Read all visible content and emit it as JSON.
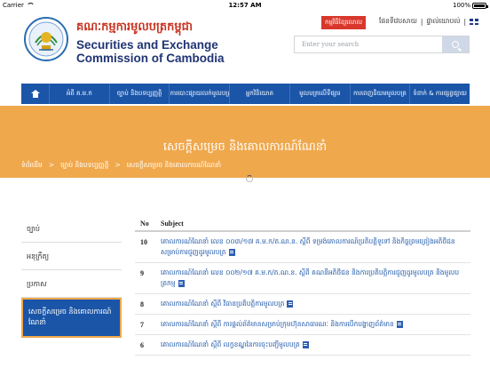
{
  "status_bar": {
    "carrier": "Carrier",
    "time": "12:57 AM",
    "battery": "100%",
    "battery_level": 1.0
  },
  "header": {
    "org_name_kh": "គណៈកម្មការមូលបត្រកម្ពុជា",
    "org_name_en_line1": "Securities and Exchange",
    "org_name_en_line2": "Commission of Cambodia",
    "complaint_button": "កម្មវិធីខ្សែលោល",
    "link_map": "ផែនទីវេបសាយ",
    "link_contact": "ផ្ទាល់យោបល់",
    "search_placeholder": "Enter your search"
  },
  "nav": {
    "items": [
      "អំពី គ.ម.ក",
      "ច្បាប់ និងបទប្បញ្ញត្តិ",
      "ការបោះផ្សាយលក់មូលបត្រ",
      "អ្នកវិនិយោគ",
      "មូលបត្រលើទីផ្សារ",
      "ការពេញនិយមមូលបត្រ",
      "ទំនាក់ & ការផ្សព្វផ្សាយ"
    ]
  },
  "banner": {
    "title": "សេចក្តីសម្រេច និងគោលការណ៍ណែនាំ",
    "breadcrumb": [
      "ទំព័រដើម",
      ">",
      "ច្បាប់ និងបទប្បញ្ញត្តិ",
      ">",
      "សេចក្តីសម្រេច និងគោលការណ៍ណែនាំ"
    ]
  },
  "sidebar": {
    "items": [
      {
        "label": "ច្បាប់",
        "active": false
      },
      {
        "label": "អនុក្រឹត្យ",
        "active": false
      },
      {
        "label": "ប្រកាស",
        "active": false
      },
      {
        "label": "សេចក្តីសម្រេច និងគោលការណ៍ណែនាំ",
        "active": true
      }
    ]
  },
  "table": {
    "headers": {
      "no": "No",
      "subject": "Subject"
    },
    "rows": [
      {
        "no": "10",
        "subject": "គោលការណ៍ណែនាំ លេខ ០០៣/១៧ គ.ម.ក/ត.ណ.ន. ស្តីពី ទម្រង់គោលការណ៍ប្រតិបត្តិទូទៅ និងកិច្ចព្រមព្រៀងអតិថិជន សម្រាប់ការជួញដូរមូលបត្រ"
      },
      {
        "no": "9",
        "subject": "គោលការណ៍ណែនាំ លេខ ០០២/១៧ គ.ម.ក/ត.ណ.ន. ស្តីពី គណនីអតិថិជន និងការប្រតិបត្តិការជួញដូរមូលបត្រ និងមូលបត្រកម្ម"
      },
      {
        "no": "8",
        "subject": "គោលការណ៍ណែនាំ ស្តីពី វិធានប្រតិបត្តិការមូលបត្រ"
      },
      {
        "no": "7",
        "subject": "គោលការណ៍ណែនាំ ស្តីពី ការផ្តល់ព័ត៌មានសម្រាប់ក្រុមហ៊ុនសាធារណៈ និងការបើកបង្ហាញព័ត៌មាន"
      },
      {
        "no": "6",
        "subject": "គោលការណ៍ណែនាំ ស្តីពី លក្ខខណ្ឌនៃការចុះបញ្ជីមូលបត្រ"
      }
    ]
  }
}
